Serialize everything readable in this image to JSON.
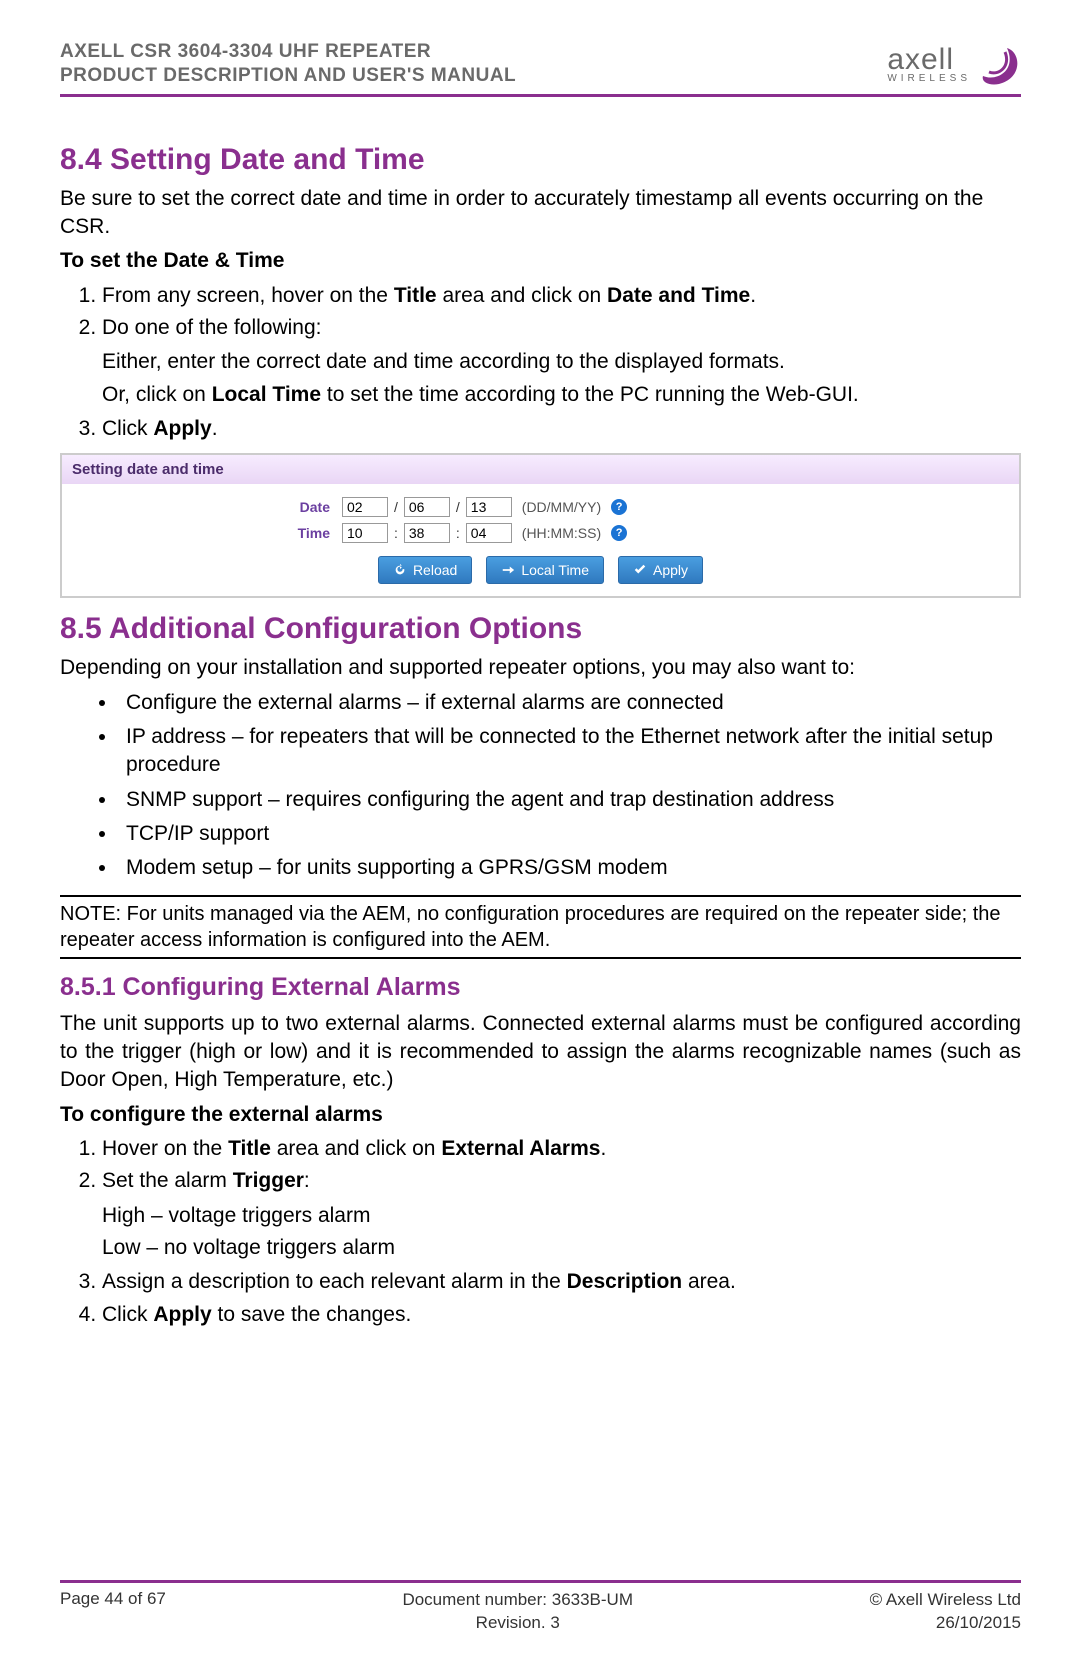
{
  "header": {
    "line1": "AXELL CSR 3604-3304 UHF REPEATER",
    "line2": "PRODUCT DESCRIPTION AND USER'S MANUAL",
    "brand": "axell",
    "brand_sub": "WIRELESS"
  },
  "s84": {
    "heading": "8.4  Setting Date and Time",
    "intro": "Be sure to set the correct date and time in order to accurately timestamp all events occurring on the CSR.",
    "subhead": "To set the Date & Time",
    "steps": {
      "s1_pre": "From any screen, hover on the ",
      "s1_b1": "Title",
      "s1_mid": " area and click on ",
      "s1_b2": "Date and Time",
      "s1_end": ".",
      "s2": "Do one of the following:",
      "s2_sub1": "Either, enter the correct date and time according to the displayed formats.",
      "s2_sub2_pre": "Or, click on ",
      "s2_sub2_b": "Local Time",
      "s2_sub2_post": " to set the time according to the PC running the Web-GUI.",
      "s3_pre": "Click ",
      "s3_b": "Apply",
      "s3_end": "."
    }
  },
  "screenshot": {
    "title": "Setting date and time",
    "date_label": "Date",
    "time_label": "Time",
    "date_dd": "02",
    "date_mm": "06",
    "date_yy": "13",
    "date_fmt": "(DD/MM/YY)",
    "time_hh": "10",
    "time_mm": "38",
    "time_ss": "04",
    "time_fmt": "(HH:MM:SS)",
    "sep_slash": "/",
    "sep_colon": ":",
    "help_char": "?",
    "btn_reload": "Reload",
    "btn_local": "Local Time",
    "btn_apply": "Apply"
  },
  "s85": {
    "heading": "8.5  Additional Configuration Options",
    "intro": "Depending on your installation and supported repeater options, you may also want to:",
    "bullets": [
      "Configure the external alarms – if external alarms are connected",
      "IP address – for repeaters that will be connected to the Ethernet network after the initial setup procedure",
      "SNMP support – requires configuring the agent and trap destination address",
      "TCP/IP support",
      "Modem setup – for units supporting a GPRS/GSM modem"
    ],
    "note": "NOTE: For units managed via the AEM, no configuration procedures are required on the repeater side; the repeater access information is configured into the AEM."
  },
  "s851": {
    "heading": "8.5.1   Configuring External Alarms",
    "intro": "The unit supports up to two external alarms. Connected external alarms must be configured according to the trigger (high or low) and it is recommended to assign the alarms recognizable names (such as Door Open, High Temperature, etc.)",
    "subhead": "To configure the external alarms",
    "steps": {
      "s1_pre": "Hover on the ",
      "s1_b1": "Title",
      "s1_mid": " area and click on ",
      "s1_b2": "External Alarms",
      "s1_end": ".",
      "s2_pre": "Set the alarm ",
      "s2_b": "Trigger",
      "s2_end": ":",
      "s2_sub1": "High – voltage triggers alarm",
      "s2_sub2": "Low – no voltage triggers alarm",
      "s3_pre": "Assign a description to each relevant alarm in the ",
      "s3_b": "Description",
      "s3_post": " area.",
      "s4_pre": "Click ",
      "s4_b": "Apply",
      "s4_post": " to save the changes."
    }
  },
  "footer": {
    "left": "Page 44 of 67",
    "mid1": "Document number: 3633B-UM",
    "mid2": "Revision. 3",
    "right1": "© Axell Wireless Ltd",
    "right2": "26/10/2015"
  }
}
